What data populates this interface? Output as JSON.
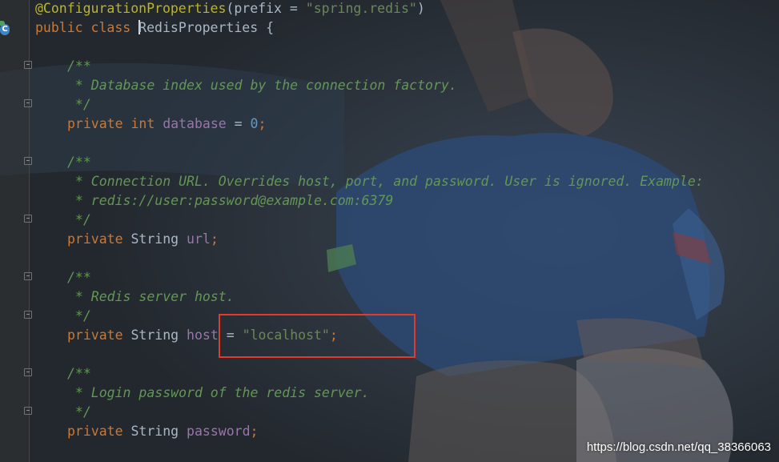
{
  "editor": {
    "class_icon_letter": "C",
    "lines": {
      "l1": {
        "annotation": "@ConfigurationProperties",
        "paren_open": "(",
        "param": "prefix",
        "eq": " = ",
        "value": "\"spring.redis\"",
        "paren_close": ")"
      },
      "l2": {
        "kw1": "public",
        "kw2": "class",
        "name": "RedisProperties",
        "brace": "{"
      },
      "l3": "/**",
      "l4": " * Database index used by the connection factory.",
      "l5": " */",
      "l6": {
        "kw": "private",
        "type": "int",
        "field": "database",
        "eq": " = ",
        "value": "0",
        "semi": ";"
      },
      "l7": "/**",
      "l8": " * Connection URL. Overrides host, port, and password. User is ignored. Example:",
      "l9": " * redis://user:password@example.com:6379",
      "l10": " */",
      "l11": {
        "kw": "private",
        "type": "String",
        "field": "url",
        "semi": ";"
      },
      "l12": "/**",
      "l13": " * Redis server host.",
      "l14": " */",
      "l15": {
        "kw": "private",
        "type": "String",
        "field": "host",
        "eq": " = ",
        "value": "\"localhost\"",
        "semi": ";"
      },
      "l16": "/**",
      "l17": " * Login password of the redis server.",
      "l18": " */",
      "l19": {
        "kw": "private",
        "type": "String",
        "field": "password",
        "semi": ";"
      }
    }
  },
  "colors": {
    "background": "#2b3036",
    "keyword": "#cc7832",
    "annotation": "#bbb529",
    "string": "#6a8759",
    "number": "#6897bb",
    "field": "#9876aa",
    "doc_comment": "#629755",
    "highlight_box": "#e33a2c"
  },
  "watermark": "https://blog.csdn.net/qq_38366063"
}
